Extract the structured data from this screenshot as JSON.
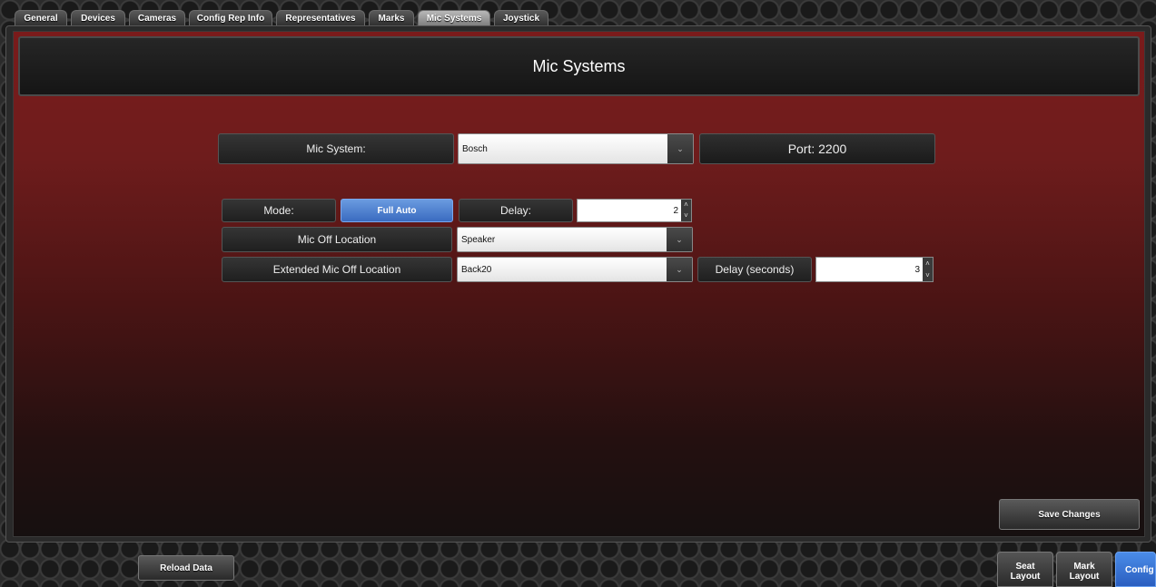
{
  "tabs": [
    {
      "label": "General",
      "active": false
    },
    {
      "label": "Devices",
      "active": false
    },
    {
      "label": "Cameras",
      "active": false
    },
    {
      "label": "Config Rep Info",
      "active": false
    },
    {
      "label": "Representatives",
      "active": false
    },
    {
      "label": "Marks",
      "active": false
    },
    {
      "label": "Mic Systems",
      "active": true
    },
    {
      "label": "Joystick",
      "active": false
    }
  ],
  "header": {
    "title": "Mic Systems"
  },
  "mic_system": {
    "label": "Mic System:",
    "selected": "Bosch",
    "port": "Port: 2200"
  },
  "mode": {
    "label": "Mode:",
    "value": "Full Auto",
    "delay_label": "Delay:",
    "delay_value": "2"
  },
  "mic_off": {
    "label": "Mic Off Location",
    "selected": "Speaker"
  },
  "extended_mic_off": {
    "label": "Extended Mic Off Location",
    "selected": "Back20",
    "delay_label": "Delay (seconds)",
    "delay_value": "3"
  },
  "actions": {
    "save": "Save Changes",
    "reload": "Reload Data"
  },
  "bottom_nav": [
    {
      "label_line1": "Seat",
      "label_line2": "Layout",
      "active": false
    },
    {
      "label_line1": "Mark",
      "label_line2": "Layout",
      "active": false
    },
    {
      "label_line1": "Config",
      "label_line2": "",
      "active": true
    }
  ],
  "colors": {
    "accent": "#4a8ce8",
    "background_red": "#7a1b1b"
  },
  "icons": {
    "dropdown": "chevron-down-icon",
    "spinner": "up-down-arrows-icon"
  }
}
